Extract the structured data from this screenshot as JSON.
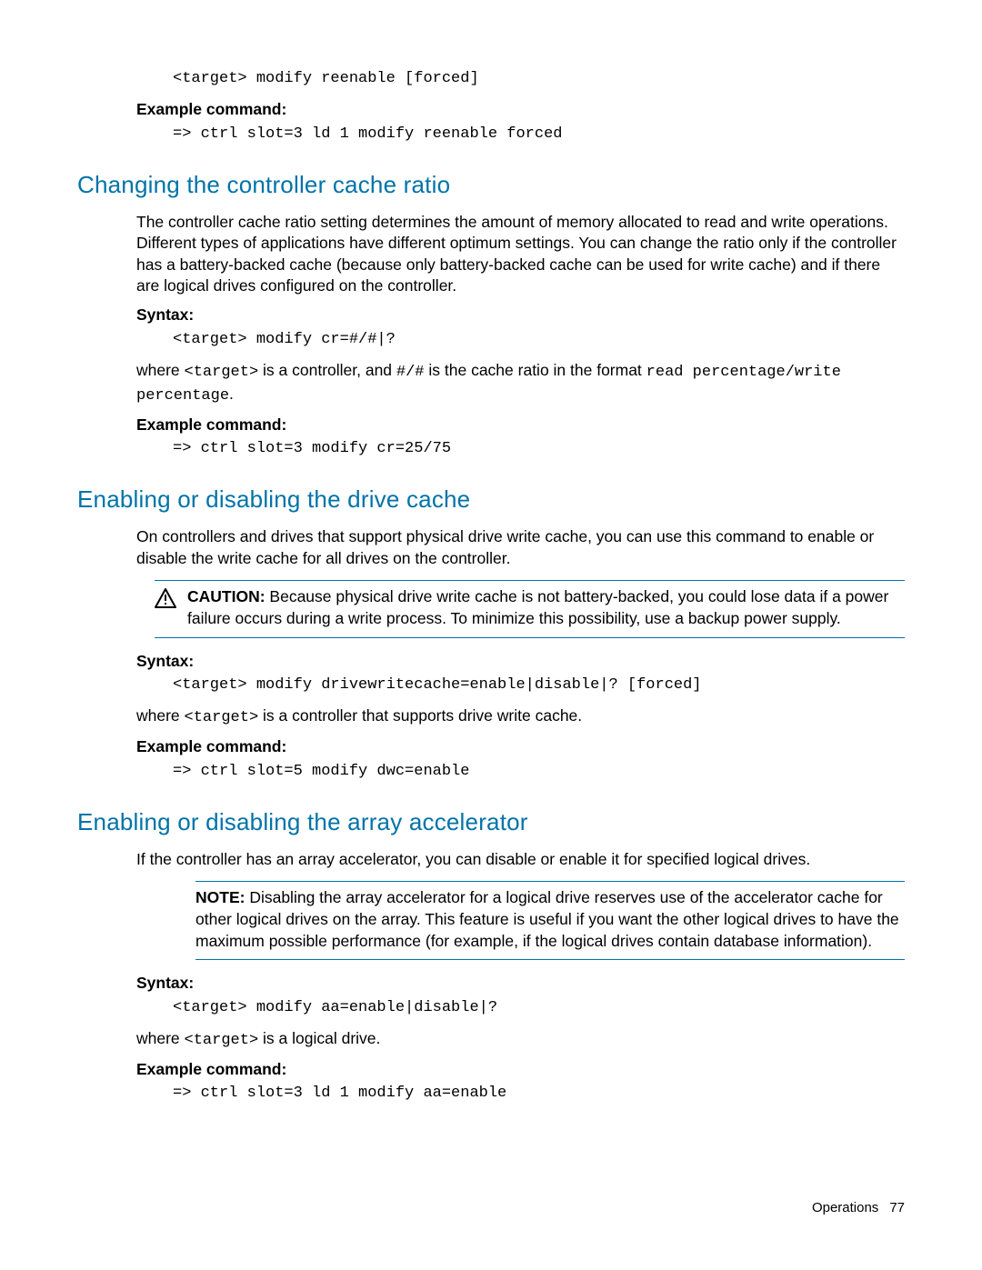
{
  "intro": {
    "code1": "<target> modify reenable [forced]",
    "example_label": "Example command:",
    "example_code": "=> ctrl slot=3 ld 1 modify reenable forced"
  },
  "section1": {
    "heading": "Changing the controller cache ratio",
    "para1": "The controller cache ratio setting determines the amount of memory allocated to read and write operations. Different types of applications have different optimum settings. You can change the ratio only if the controller has a battery-backed cache (because only battery-backed cache can be used for write cache) and if there are logical drives configured on the controller.",
    "syntax_label": "Syntax:",
    "syntax_code": "<target> modify cr=#/#|?",
    "where_pre": "where ",
    "where_t": "<target>",
    "where_mid": " is a controller, and ",
    "where_hash": "#/#",
    "where_mid2": " is the cache ratio in the format ",
    "where_fmt": "read percentage/write percentage",
    "where_end": ".",
    "example_label": "Example command:",
    "example_code": "=> ctrl slot=3 modify cr=25/75"
  },
  "section2": {
    "heading": "Enabling or disabling the drive cache",
    "para1": "On controllers and drives that support physical drive write cache, you can use this command to enable or disable the write cache for all drives on the controller.",
    "caution_label": "CAUTION:",
    "caution_text": "  Because physical drive write cache is not battery-backed, you could lose data if a power failure occurs during a write process. To minimize this possibility, use a backup power supply.",
    "syntax_label": "Syntax:",
    "syntax_code": "<target> modify drivewritecache=enable|disable|? [forced]",
    "where_pre": "where ",
    "where_t": "<target>",
    "where_end": " is a controller that supports drive write cache.",
    "example_label": "Example command:",
    "example_code": "=> ctrl slot=5 modify dwc=enable"
  },
  "section3": {
    "heading": "Enabling or disabling the array accelerator",
    "para1": "If the controller has an array accelerator, you can disable or enable it for specified logical drives.",
    "note_label": "NOTE:",
    "note_text": "  Disabling the array accelerator for a logical drive reserves use of the accelerator cache for other logical drives on the array. This feature is useful if you want the other logical drives to have the maximum possible performance (for example, if the logical drives contain database information).",
    "syntax_label": "Syntax:",
    "syntax_code": "<target> modify aa=enable|disable|?",
    "where_pre": "where ",
    "where_t": "<target>",
    "where_end": " is a logical drive.",
    "example_label": "Example command:",
    "example_code": "=> ctrl slot=3 ld 1 modify aa=enable"
  },
  "footer": {
    "section": "Operations",
    "page": "77"
  }
}
